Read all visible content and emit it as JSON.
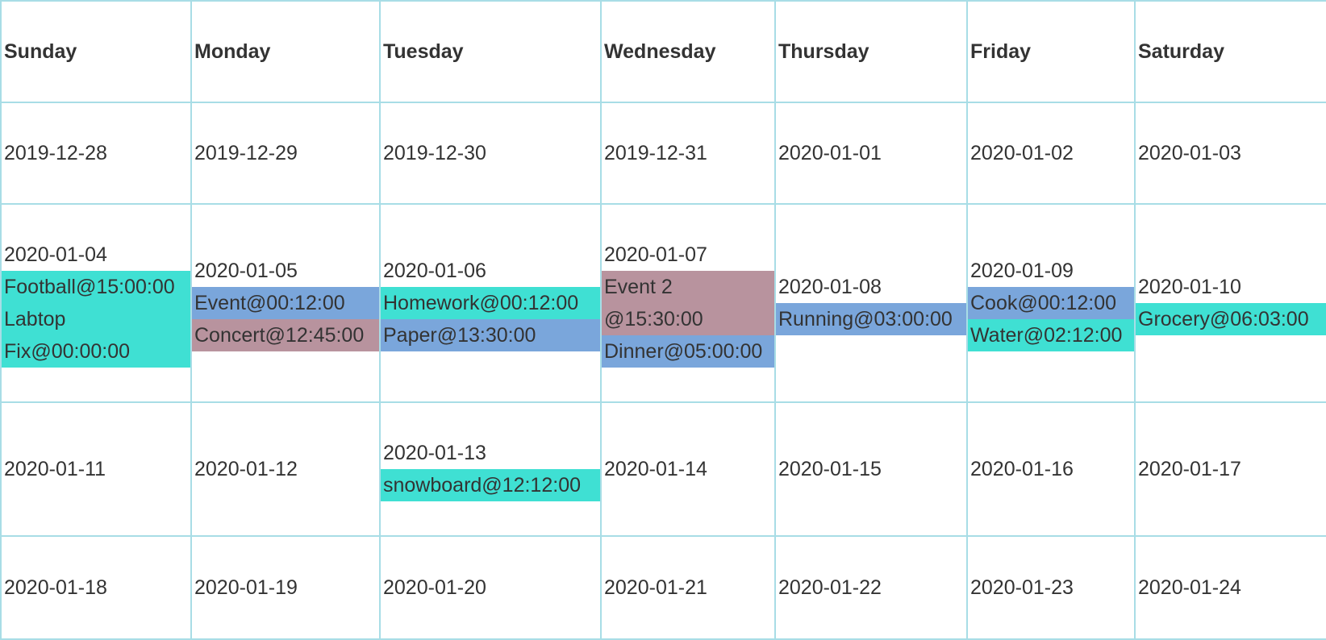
{
  "calendar": {
    "days": [
      "Sunday",
      "Monday",
      "Tuesday",
      "Wednesday",
      "Thursday",
      "Friday",
      "Saturday"
    ],
    "weeks": [
      [
        {
          "date": "2019-12-28",
          "events": []
        },
        {
          "date": "2019-12-29",
          "events": []
        },
        {
          "date": "2019-12-30",
          "events": []
        },
        {
          "date": "2019-12-31",
          "events": []
        },
        {
          "date": "2020-01-01",
          "events": []
        },
        {
          "date": "2020-01-02",
          "events": []
        },
        {
          "date": "2020-01-03",
          "events": []
        }
      ],
      [
        {
          "date": "2020-01-04",
          "events": [
            {
              "label": "Football@15:00:00",
              "color": "#3fe0d3"
            },
            {
              "label": "Labtop Fix@00:00:00",
              "color": "#3fe0d3"
            }
          ]
        },
        {
          "date": "2020-01-05",
          "events": [
            {
              "label": "Event@00:12:00",
              "color": "#7aa6db"
            },
            {
              "label": "Concert@12:45:00",
              "color": "#b8939e"
            }
          ]
        },
        {
          "date": "2020-01-06",
          "events": [
            {
              "label": "Homework@00:12:00",
              "color": "#3fe0d3"
            },
            {
              "label": "Paper@13:30:00",
              "color": "#7aa6db"
            }
          ]
        },
        {
          "date": "2020-01-07",
          "events": [
            {
              "label": "Event 2 @15:30:00",
              "color": "#b8939e"
            },
            {
              "label": "Dinner@05:00:00",
              "color": "#7aa6db"
            }
          ]
        },
        {
          "date": "2020-01-08",
          "events": [
            {
              "label": "Running@03:00:00",
              "color": "#7aa6db"
            }
          ]
        },
        {
          "date": "2020-01-09",
          "events": [
            {
              "label": "Cook@00:12:00",
              "color": "#7aa6db"
            },
            {
              "label": "Water@02:12:00",
              "color": "#3fe0d3"
            }
          ]
        },
        {
          "date": "2020-01-10",
          "events": [
            {
              "label": "Grocery@06:03:00",
              "color": "#3fe0d3"
            }
          ]
        }
      ],
      [
        {
          "date": "2020-01-11",
          "events": []
        },
        {
          "date": "2020-01-12",
          "events": []
        },
        {
          "date": "2020-01-13",
          "events": [
            {
              "label": "snowboard@12:12:00",
              "color": "#3fe0d3"
            }
          ]
        },
        {
          "date": "2020-01-14",
          "events": []
        },
        {
          "date": "2020-01-15",
          "events": []
        },
        {
          "date": "2020-01-16",
          "events": []
        },
        {
          "date": "2020-01-17",
          "events": []
        }
      ],
      [
        {
          "date": "2020-01-18",
          "events": []
        },
        {
          "date": "2020-01-19",
          "events": []
        },
        {
          "date": "2020-01-20",
          "events": []
        },
        {
          "date": "2020-01-21",
          "events": []
        },
        {
          "date": "2020-01-22",
          "events": []
        },
        {
          "date": "2020-01-23",
          "events": []
        },
        {
          "date": "2020-01-24",
          "events": []
        }
      ]
    ]
  }
}
